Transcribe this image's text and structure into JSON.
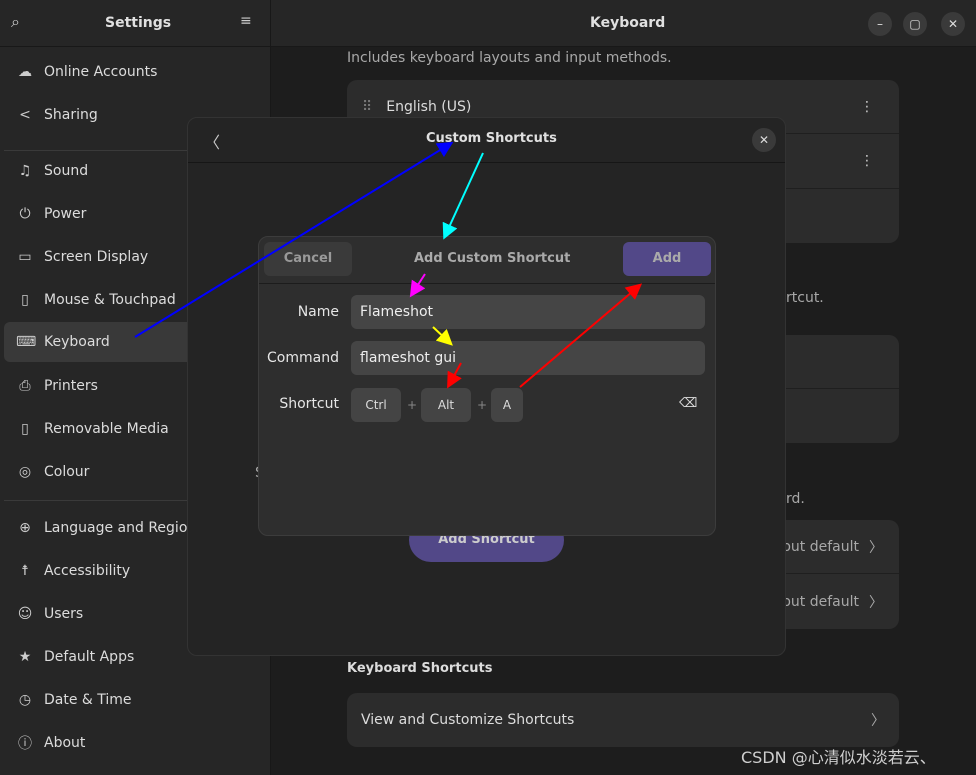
{
  "sidebar": {
    "title": "Settings",
    "search_icon": "search-icon",
    "menu_icon": "hamburger-icon",
    "items": [
      {
        "label": "Online Accounts",
        "icon": "cloud-icon"
      },
      {
        "label": "Sharing",
        "icon": "share-icon"
      },
      {
        "label": "Sound",
        "icon": "music-note-icon"
      },
      {
        "label": "Power",
        "icon": "power-icon"
      },
      {
        "label": "Screen Display",
        "icon": "monitor-icon"
      },
      {
        "label": "Mouse & Touchpad",
        "icon": "mouse-icon"
      },
      {
        "label": "Keyboard",
        "icon": "keyboard-icon",
        "selected": true
      },
      {
        "label": "Printers",
        "icon": "printer-icon"
      },
      {
        "label": "Removable Media",
        "icon": "usb-icon"
      },
      {
        "label": "Colour",
        "icon": "palette-icon"
      },
      {
        "label": "Language and Region",
        "icon": "globe-icon"
      },
      {
        "label": "Accessibility",
        "icon": "accessibility-icon"
      },
      {
        "label": "Users",
        "icon": "users-icon"
      },
      {
        "label": "Default Apps",
        "icon": "star-icon"
      },
      {
        "label": "Date & Time",
        "icon": "clock-icon"
      },
      {
        "label": "About",
        "icon": "info-icon"
      }
    ]
  },
  "main": {
    "title": "Keyboard",
    "input_sources_desc": "Includes keyboard layouts and input methods.",
    "input_source": "English (US)",
    "fragment_shortcut": "rtcut.",
    "fragment_keyboard": "rd.",
    "row_layout_default_1": "yout default",
    "row_layout_default_2": "yout default",
    "keyboard_shortcuts_heading": "Keyboard Shortcuts",
    "view_customize": "View and Customize Shortcuts"
  },
  "custom_shortcuts": {
    "title": "Custom Shortcuts",
    "fragment": "S",
    "add_shortcut_button": "Add Shortcut"
  },
  "add_custom_shortcut": {
    "title": "Add Custom Shortcut",
    "cancel": "Cancel",
    "add": "Add",
    "name_label": "Name",
    "name_value": "Flameshot",
    "command_label": "Command",
    "command_value": "flameshot gui",
    "shortcut_label": "Shortcut",
    "keys": [
      "Ctrl",
      "Alt",
      "A"
    ],
    "separator": "+"
  },
  "watermark": "CSDN @心清似水淡若云、",
  "colors": {
    "accent": "#524888",
    "selected": "#393939",
    "arrow_blue": "#0000ff",
    "arrow_cyan": "#00ffff",
    "arrow_magenta": "#ff00ff",
    "arrow_yellow": "#ffff00",
    "arrow_red": "#ff0000"
  }
}
